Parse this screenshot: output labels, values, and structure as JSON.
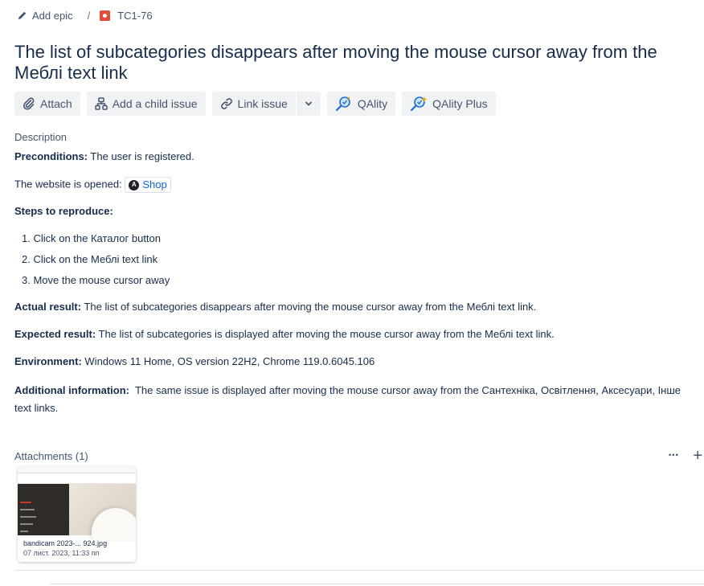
{
  "breadcrumb": {
    "add_epic": "Add epic",
    "separator": "/",
    "issue_key": "TC1-76"
  },
  "issue": {
    "title": "The list of subcategories disappears after moving the mouse cursor away from the Меблі text link"
  },
  "toolbar": {
    "attach": "Attach",
    "add_child": "Add a child issue",
    "link_issue": "Link issue",
    "qality": "QAlity",
    "qality_plus": "QAlity Plus"
  },
  "description": {
    "label": "Description",
    "preconditions_label": "Preconditions:",
    "preconditions_text": " The user is registered.",
    "website_text": "The website is opened: ",
    "website_link": "Shop",
    "steps_label": "Steps to reproduce:",
    "steps": [
      "1. Click on the Каталог button",
      "2. Click on the Меблі text link",
      "3. Move the mouse cursor away"
    ],
    "actual_label": "Actual result:",
    "actual_text": " The list of subcategories disappears after moving the mouse cursor away from the Меблі text link.",
    "expected_label": "Expected result:",
    "expected_text": " The list of subcategories is displayed after moving the mouse cursor away from the Меблі text link.",
    "environment_label": "Environment:",
    "environment_text": " Windows 11 Home, OS version 22H2, Chrome 119.0.6045.106",
    "additional_label": "Additional information:",
    "additional_text": "  The same issue is displayed after moving the mouse cursor away from the Сантехніка, Освітлення, Аксесуари, Інше text links."
  },
  "attachments": {
    "header": "Attachments (1)",
    "more_icon": "more-icon",
    "add_icon": "plus-icon",
    "files": [
      {
        "name": "bandicam 2023-... 924.jpg",
        "date": "07 лист. 2023, 11:33 пп"
      }
    ]
  },
  "colors": {
    "link": "#0c66e4",
    "bug": "#e5493a",
    "button_bg": "#f1f2f4",
    "text": "#172b4d"
  }
}
